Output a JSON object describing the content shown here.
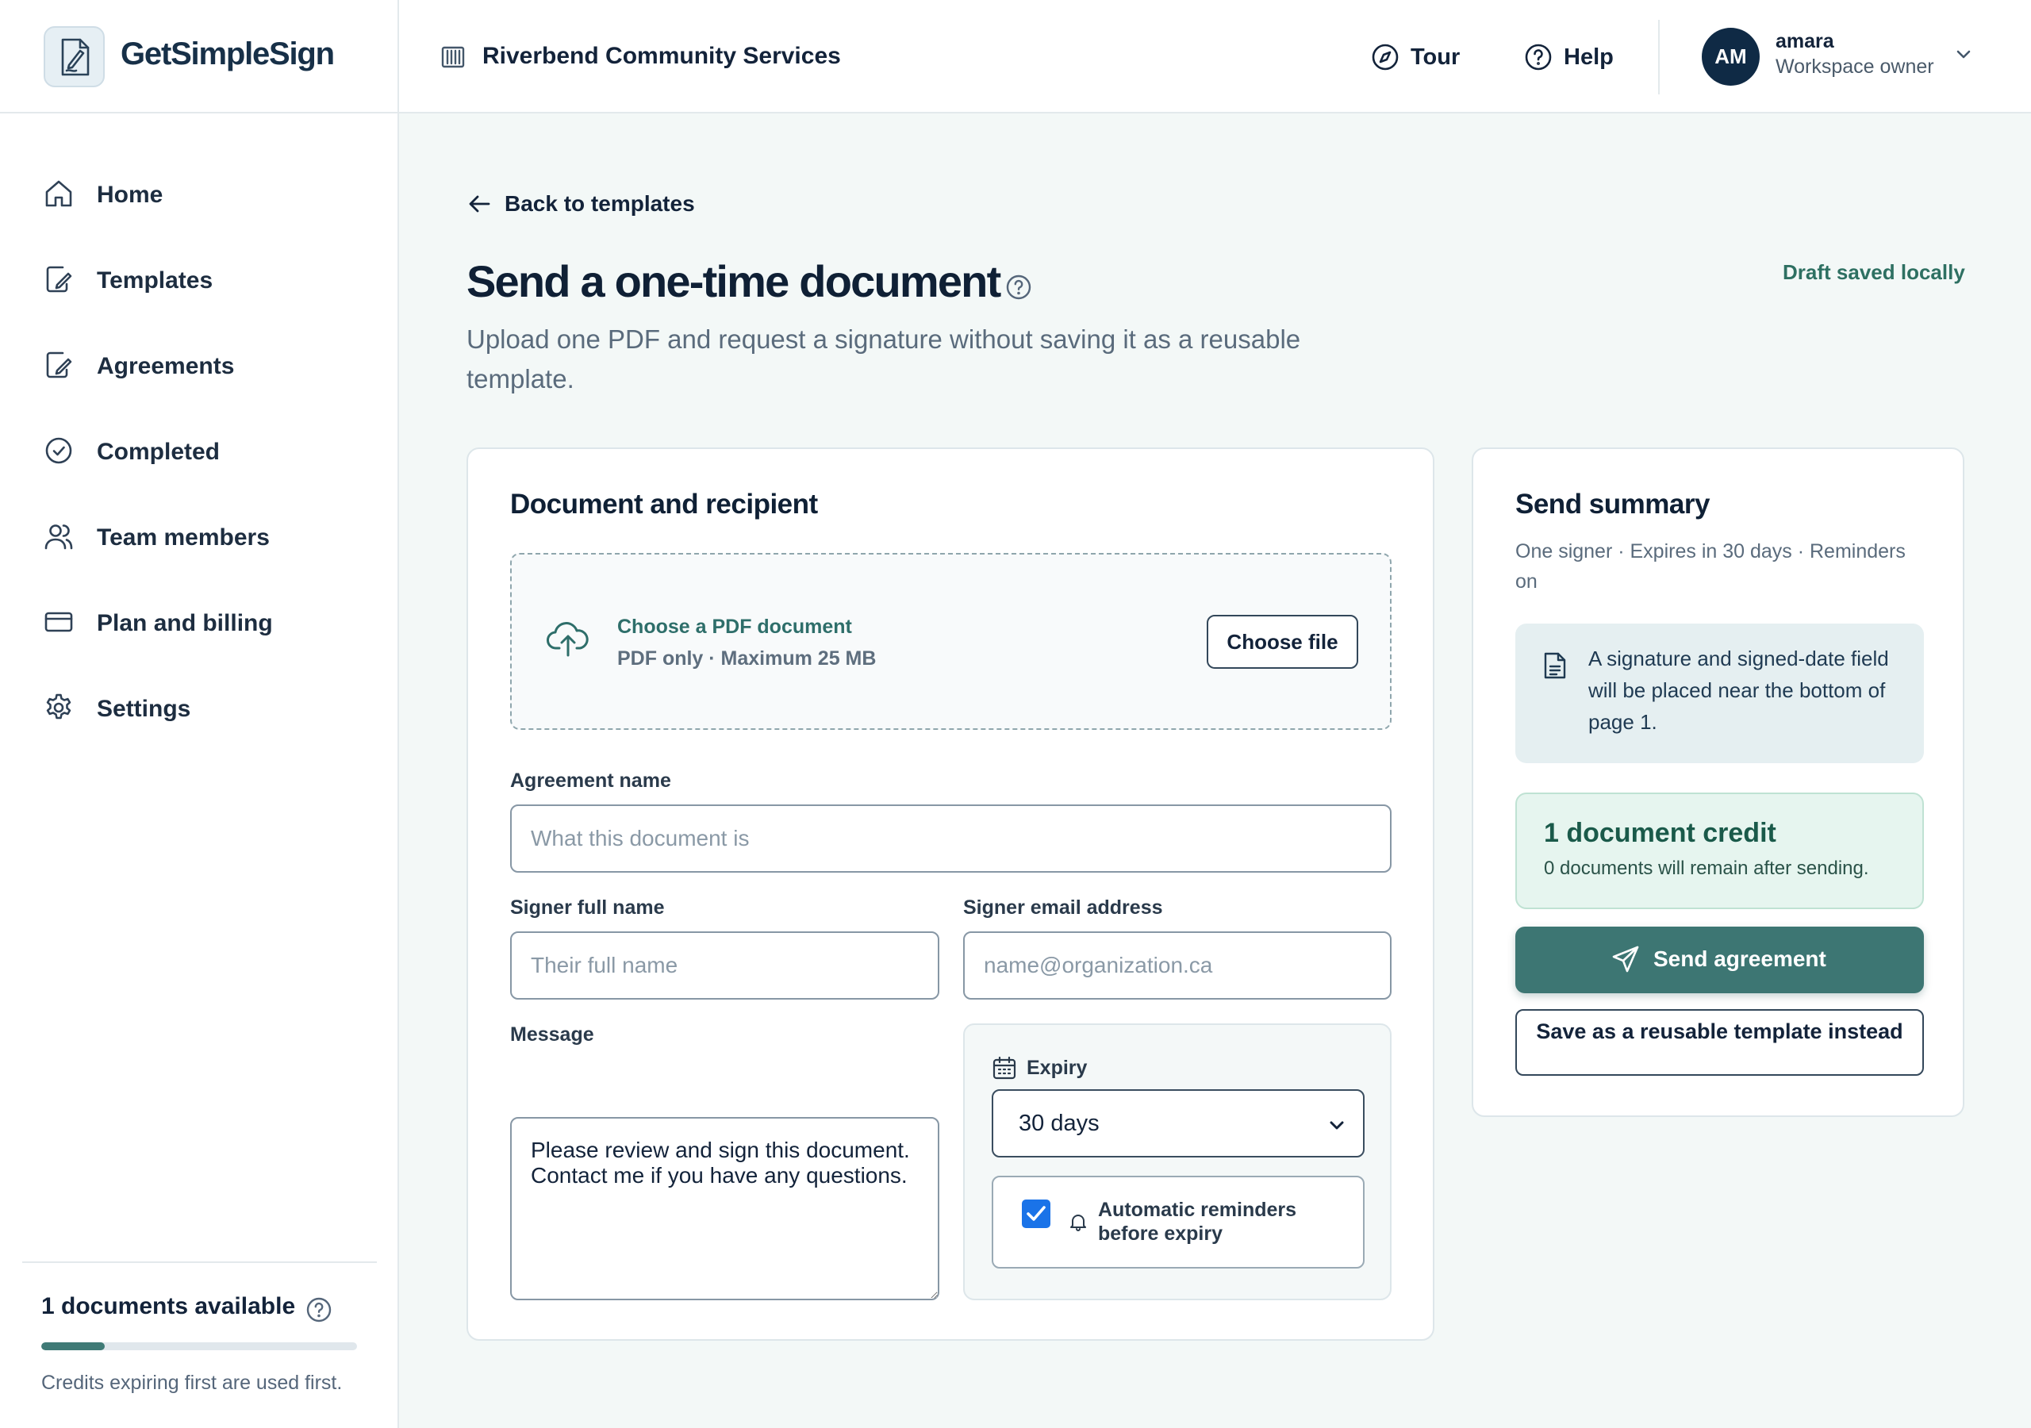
{
  "app": {
    "brand": "GetSimpleSign",
    "organization": "Riverbend Community Services"
  },
  "header": {
    "tour_label": "Tour",
    "help_label": "Help",
    "user": {
      "initials": "AM",
      "name": "amara",
      "role": "Workspace owner"
    }
  },
  "sidebar": {
    "items": [
      {
        "label": "Home",
        "icon": "home-icon"
      },
      {
        "label": "Templates",
        "icon": "template-icon"
      },
      {
        "label": "Agreements",
        "icon": "agreement-icon"
      },
      {
        "label": "Completed",
        "icon": "check-circle-icon"
      },
      {
        "label": "Team members",
        "icon": "users-icon"
      },
      {
        "label": "Plan and billing",
        "icon": "credit-card-icon"
      },
      {
        "label": "Settings",
        "icon": "gear-icon"
      }
    ],
    "credits": {
      "title": "1 documents available",
      "progress_fraction": 0.2,
      "note": "Credits expiring first are used first."
    }
  },
  "page": {
    "back_label": "Back to templates",
    "title": "Send a one-time document",
    "subtitle": "Upload one PDF and request a signature without saving it as a reusable template.",
    "draft_status": "Draft saved locally"
  },
  "form": {
    "section_title": "Document and recipient",
    "upload": {
      "title": "Choose a PDF document",
      "hint": "PDF only · Maximum 25 MB",
      "button": "Choose file"
    },
    "agreement_name": {
      "label": "Agreement name",
      "placeholder": "What this document is",
      "value": ""
    },
    "signer_name": {
      "label": "Signer full name",
      "placeholder": "Their full name",
      "value": ""
    },
    "signer_email": {
      "label": "Signer email address",
      "placeholder": "name@organization.ca",
      "value": ""
    },
    "message": {
      "label": "Message",
      "value": "Please review and sign this document. Contact me if you have any questions."
    },
    "expiry": {
      "label": "Expiry",
      "selected": "30 days"
    },
    "reminders": {
      "label": "Automatic reminders before expiry",
      "checked": true
    }
  },
  "summary": {
    "title": "Send summary",
    "subtitle": "One signer · Expires in 30 days · Reminders on",
    "info": "A signature and signed-date field will be placed near the bottom of page 1.",
    "credit_title": "1 document credit",
    "credit_sub": "0 documents will remain after sending.",
    "send_button": "Send agreement",
    "template_button": "Save as a reusable template instead"
  },
  "colors": {
    "accent": "#3d7673",
    "brand_dark": "#0f2a45",
    "success_bg": "#e6f5ef",
    "checkbox": "#1a73e8"
  }
}
